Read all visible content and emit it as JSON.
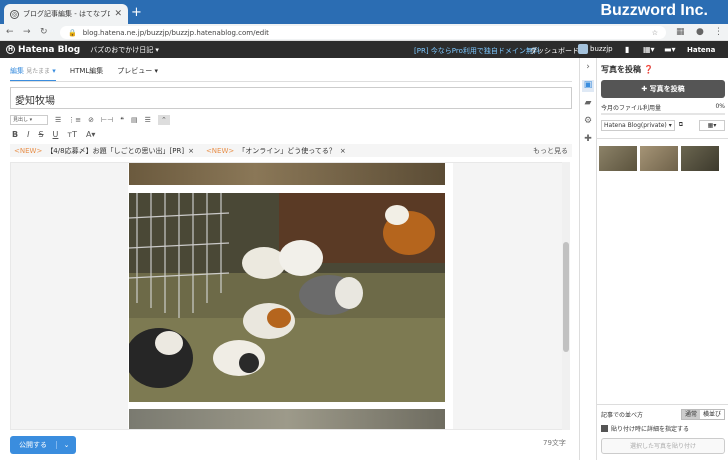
{
  "browser": {
    "tab_title": "ブログ記事編集 - はてなブログ",
    "url": "blog.hatena.ne.jp/buzzjp/buzzjp.hatenablog.com/edit",
    "watermark": "Buzzword Inc."
  },
  "header": {
    "logo": "Hatena Blog",
    "blog_name": "バズのおでかけ日記 ▾",
    "pro_link": "[PR] 今ならPro利用で独自ドメイン無料",
    "dashboard": "ダッシュボード",
    "user": "buzzjp",
    "hatena": "Hatena"
  },
  "editor": {
    "tabs": [
      {
        "label": "編集",
        "sub": "見たまま"
      },
      {
        "label": "HTML編集",
        "sub": ""
      },
      {
        "label": "プレビュー",
        "sub": ""
      }
    ],
    "title_value": "愛知牧場",
    "format_select": "見出し",
    "notice": {
      "new1": "<NEW>",
      "text1": "【4/8応募〆】お題「しごとの思い出」[PR]",
      "new2": "<NEW>",
      "text2": "「オンライン」どう使ってる？",
      "more": "もっと見る"
    },
    "publish": "公開する",
    "char_count": "79文字"
  },
  "panel": {
    "title": "写真を投稿",
    "upload_button": "✚ 写真を投稿",
    "usage_label": "今月のファイル利用量",
    "usage_value": "0%",
    "usage_fraction": 0,
    "album": "Hatena Blog(private)",
    "order_label": "記事での並べ方",
    "order_options": [
      "通常",
      "横並び"
    ],
    "detail_label": "貼り付け時に詳細を指定する",
    "paste_button": "選択した写真を貼り付け"
  },
  "icons": {
    "toolbar1": [
      "list-icon",
      "ordered-list-icon",
      "link-icon",
      "hr-icon",
      "quote-icon",
      "table-icon",
      "align-icon",
      "collapse-icon"
    ],
    "toolbar2": [
      "bold-icon",
      "italic-icon",
      "strike-icon",
      "underline-icon",
      "font-size-icon",
      "font-color-icon"
    ]
  }
}
